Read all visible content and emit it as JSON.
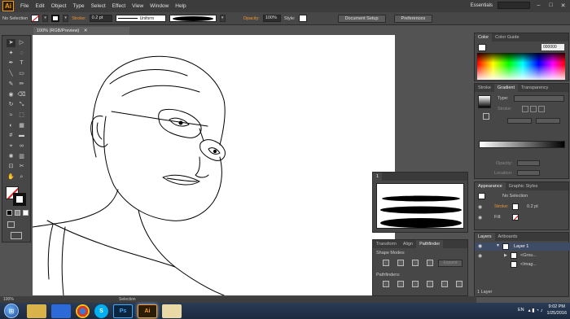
{
  "app": {
    "logo": "Ai",
    "menus": [
      "File",
      "Edit",
      "Object",
      "Type",
      "Select",
      "Effect",
      "View",
      "Window",
      "Help"
    ],
    "workspace": "Essentials",
    "window_controls": [
      "–",
      "□",
      "✕"
    ]
  },
  "control_bar": {
    "selection_label": "No Selection",
    "stroke_label": "Stroke:",
    "stroke_value": "0.2 pt",
    "profile_value": "Uniform",
    "opacity_label": "Opacity:",
    "opacity_value": "100%",
    "style_label": "Style:",
    "document_setup": "Document Setup",
    "preferences": "Preferences"
  },
  "document": {
    "tab_title": "100% (RGB/Preview)",
    "close_glyph": "✕"
  },
  "status_bar": {
    "zoom": "100%",
    "tool": "Selection"
  },
  "tools": {
    "icons": [
      "selection-tool-icon",
      "direct-selection-tool-icon",
      "magic-wand-tool-icon",
      "lasso-tool-icon",
      "pen-tool-icon",
      "type-tool-icon",
      "line-tool-icon",
      "rectangle-tool-icon",
      "paintbrush-tool-icon",
      "pencil-tool-icon",
      "blob-brush-tool-icon",
      "eraser-tool-icon",
      "rotate-tool-icon",
      "scale-tool-icon",
      "width-tool-icon",
      "free-transform-tool-icon",
      "shape-builder-tool-icon",
      "perspective-grid-tool-icon",
      "mesh-tool-icon",
      "gradient-tool-icon",
      "eyedropper-tool-icon",
      "blend-tool-icon",
      "symbol-sprayer-tool-icon",
      "graph-tool-icon",
      "artboard-tool-icon",
      "slice-tool-icon",
      "hand-tool-icon",
      "zoom-tool-icon"
    ],
    "glyphs": [
      "➤",
      "▷",
      "✦",
      "◌",
      "✒",
      "T",
      "╲",
      "▭",
      "✎",
      "✏",
      "◉",
      "⌫",
      "↻",
      "⤡",
      "≈",
      "⬚",
      "◐",
      "▦",
      "#",
      "▬",
      "⌖",
      "∞",
      "✺",
      "▥",
      "⊡",
      "✂",
      "✋",
      "⌕"
    ]
  },
  "color_panel": {
    "tabs": [
      "Color",
      "Color Guide"
    ],
    "hex_value": "000000",
    "colors": {
      "accent": "#f0952e"
    }
  },
  "gradient_panel": {
    "tabs": [
      "Stroke",
      "Gradient",
      "Transparency"
    ],
    "type_label": "Type:",
    "stroke_label": "Stroke:",
    "opacity_label": "Opacity:",
    "location_label": "Location:"
  },
  "appearance_panel": {
    "tabs": [
      "Appearance",
      "Graphic Styles"
    ],
    "selection": "No Selection",
    "stroke_label": "Stroke:",
    "stroke_value": "0.2 pt",
    "fill_label": "Fill:"
  },
  "layers_panel": {
    "tabs": [
      "Layers",
      "Artboards"
    ],
    "layer_name": "Layer 1",
    "sublayers": [
      "<Grou...",
      "<Imag..."
    ],
    "footer": "1 Layer"
  },
  "brush_panel": {
    "tab": "1"
  },
  "pathfinder_panel": {
    "tabs": [
      "Transform",
      "Align",
      "Pathfinder"
    ],
    "shape_modes_label": "Shape Modes:",
    "pathfinders_label": "Pathfinders:",
    "expand_label": "Expand"
  },
  "taskbar": {
    "apps": [
      "explorer",
      "media",
      "chrome",
      "skype",
      "photoshop",
      "illustrator",
      "paint"
    ],
    "app_labels": [
      "",
      "",
      "",
      "S",
      "Ps",
      "Ai",
      ""
    ],
    "language": "EN",
    "time": "9:02 PM",
    "date": "1/25/2016"
  }
}
